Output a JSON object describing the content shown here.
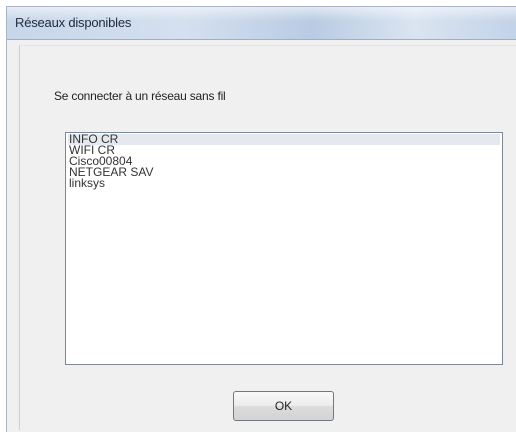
{
  "window": {
    "title": "Réseaux disponibles"
  },
  "dialog": {
    "prompt": "Se connecter à un réseau sans fil",
    "networks": [
      "INFO CR",
      "WIFI  CR",
      "Cisco00804",
      "NETGEAR SAV",
      "linksys"
    ],
    "selected_index": 0,
    "ok_label": "OK"
  }
}
